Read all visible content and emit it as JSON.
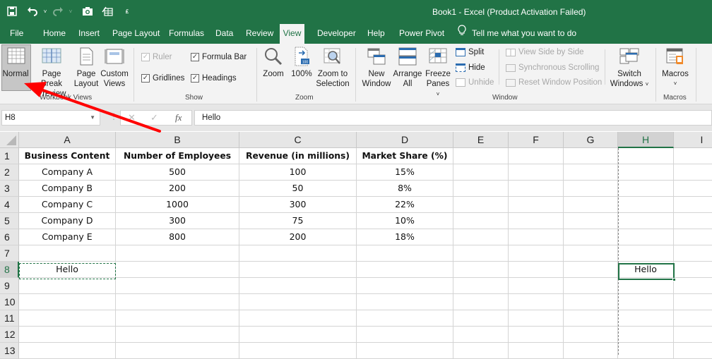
{
  "window": {
    "title": "Book1  -  Excel (Product Activation Failed)"
  },
  "quick_access": {
    "save": "save-icon",
    "undo": "undo-icon",
    "redo": "redo-icon",
    "camera": "camera-icon",
    "form": "form-icon",
    "customize": "customize-qat-icon"
  },
  "tabs": [
    {
      "label": "File"
    },
    {
      "label": "Home"
    },
    {
      "label": "Insert"
    },
    {
      "label": "Page Layout"
    },
    {
      "label": "Formulas"
    },
    {
      "label": "Data"
    },
    {
      "label": "Review"
    },
    {
      "label": "View",
      "active": true
    },
    {
      "label": "Developer"
    },
    {
      "label": "Help"
    },
    {
      "label": "Power Pivot"
    }
  ],
  "tell_me": "Tell me what you want to do",
  "ribbon": {
    "workbook_views": {
      "label": "Workbook Views",
      "normal": "Normal",
      "page_break_1": "Page Break",
      "page_break_2": "Preview",
      "page_layout_1": "Page",
      "page_layout_2": "Layout",
      "custom_1": "Custom",
      "custom_2": "Views"
    },
    "show": {
      "label": "Show",
      "ruler": {
        "label": "Ruler",
        "checked": true,
        "disabled": true
      },
      "formula_bar": {
        "label": "Formula Bar",
        "checked": true
      },
      "gridlines": {
        "label": "Gridlines",
        "checked": true
      },
      "headings": {
        "label": "Headings",
        "checked": true
      }
    },
    "zoom": {
      "label": "Zoom",
      "zoom": "Zoom",
      "hundred": "100%",
      "zoom_sel_1": "Zoom to",
      "zoom_sel_2": "Selection"
    },
    "window": {
      "label": "Window",
      "new_1": "New",
      "new_2": "Window",
      "arrange_1": "Arrange",
      "arrange_2": "All",
      "freeze_1": "Freeze",
      "freeze_2": "Panes",
      "split": "Split",
      "hide": "Hide",
      "unhide": "Unhide",
      "side_by_side": "View Side by Side",
      "sync_scroll": "Synchronous Scrolling",
      "reset_pos": "Reset Window Position",
      "switch_1": "Switch",
      "switch_2": "Windows"
    },
    "macros": {
      "label": "Macros",
      "macros": "Macros"
    }
  },
  "formula_bar": {
    "name_box": "H8",
    "formula": "Hello"
  },
  "sheet": {
    "columns": [
      "A",
      "B",
      "C",
      "D",
      "E",
      "F",
      "G",
      "H",
      "I"
    ],
    "selected_column": "H",
    "rows": [
      "1",
      "2",
      "3",
      "4",
      "5",
      "6",
      "7",
      "8",
      "9",
      "10",
      "11",
      "12",
      "13"
    ],
    "selected_row": "8",
    "headers": [
      "Business Content",
      "Number of Employees",
      "Revenue (in millions)",
      "Market Share (%)"
    ],
    "data": [
      [
        "Company A",
        "500",
        "100",
        "15%"
      ],
      [
        "Company B",
        "200",
        "50",
        "8%"
      ],
      [
        "Company C",
        "1000",
        "300",
        "22%"
      ],
      [
        "Company D",
        "300",
        "75",
        "10%"
      ],
      [
        "Company E",
        "800",
        "200",
        "18%"
      ]
    ],
    "a8": "Hello",
    "h8": "Hello",
    "active_cell": "H8",
    "copied_cell": "A8"
  },
  "colors": {
    "brand_green": "#217346",
    "annotation_red": "#ff0000"
  }
}
